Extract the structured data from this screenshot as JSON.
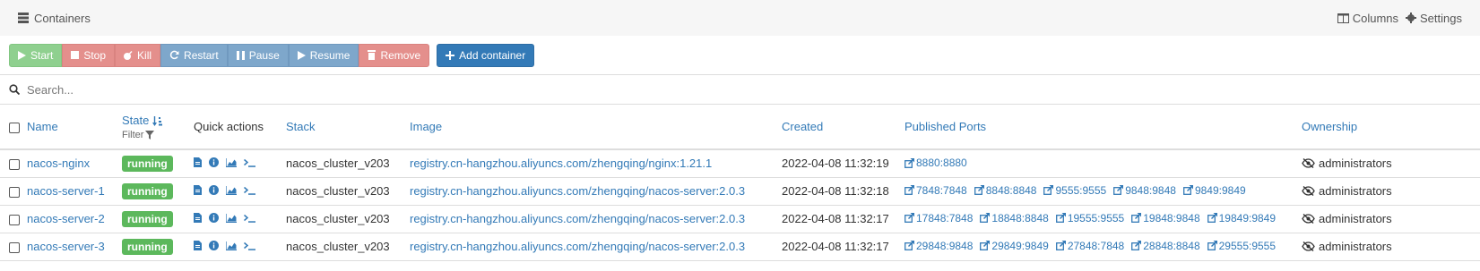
{
  "header": {
    "title": "Containers",
    "columns_label": "Columns",
    "settings_label": "Settings"
  },
  "toolbar": {
    "start": "Start",
    "stop": "Stop",
    "kill": "Kill",
    "restart": "Restart",
    "pause": "Pause",
    "resume": "Resume",
    "remove": "Remove",
    "add_container": "Add container"
  },
  "search": {
    "placeholder": "Search..."
  },
  "table": {
    "headers": {
      "name": "Name",
      "state": "State",
      "filter": "Filter",
      "quick_actions": "Quick actions",
      "stack": "Stack",
      "image": "Image",
      "created": "Created",
      "ports": "Published Ports",
      "ownership": "Ownership"
    },
    "rows": [
      {
        "name": "nacos-nginx",
        "state": "running",
        "stack": "nacos_cluster_v203",
        "image": "registry.cn-hangzhou.aliyuncs.com/zhengqing/nginx:1.21.1",
        "created": "2022-04-08 11:32:19",
        "ports": [
          "8880:8880"
        ],
        "ownership": "administrators"
      },
      {
        "name": "nacos-server-1",
        "state": "running",
        "stack": "nacos_cluster_v203",
        "image": "registry.cn-hangzhou.aliyuncs.com/zhengqing/nacos-server:2.0.3",
        "created": "2022-04-08 11:32:18",
        "ports": [
          "7848:7848",
          "8848:8848",
          "9555:9555",
          "9848:9848",
          "9849:9849"
        ],
        "ownership": "administrators"
      },
      {
        "name": "nacos-server-2",
        "state": "running",
        "stack": "nacos_cluster_v203",
        "image": "registry.cn-hangzhou.aliyuncs.com/zhengqing/nacos-server:2.0.3",
        "created": "2022-04-08 11:32:17",
        "ports": [
          "17848:7848",
          "18848:8848",
          "19555:9555",
          "19848:9848",
          "19849:9849"
        ],
        "ownership": "administrators"
      },
      {
        "name": "nacos-server-3",
        "state": "running",
        "stack": "nacos_cluster_v203",
        "image": "registry.cn-hangzhou.aliyuncs.com/zhengqing/nacos-server:2.0.3",
        "created": "2022-04-08 11:32:17",
        "ports": [
          "29848:9848",
          "29849:9849",
          "27848:7848",
          "28848:8848",
          "29555:9555"
        ],
        "ownership": "administrators"
      }
    ]
  }
}
